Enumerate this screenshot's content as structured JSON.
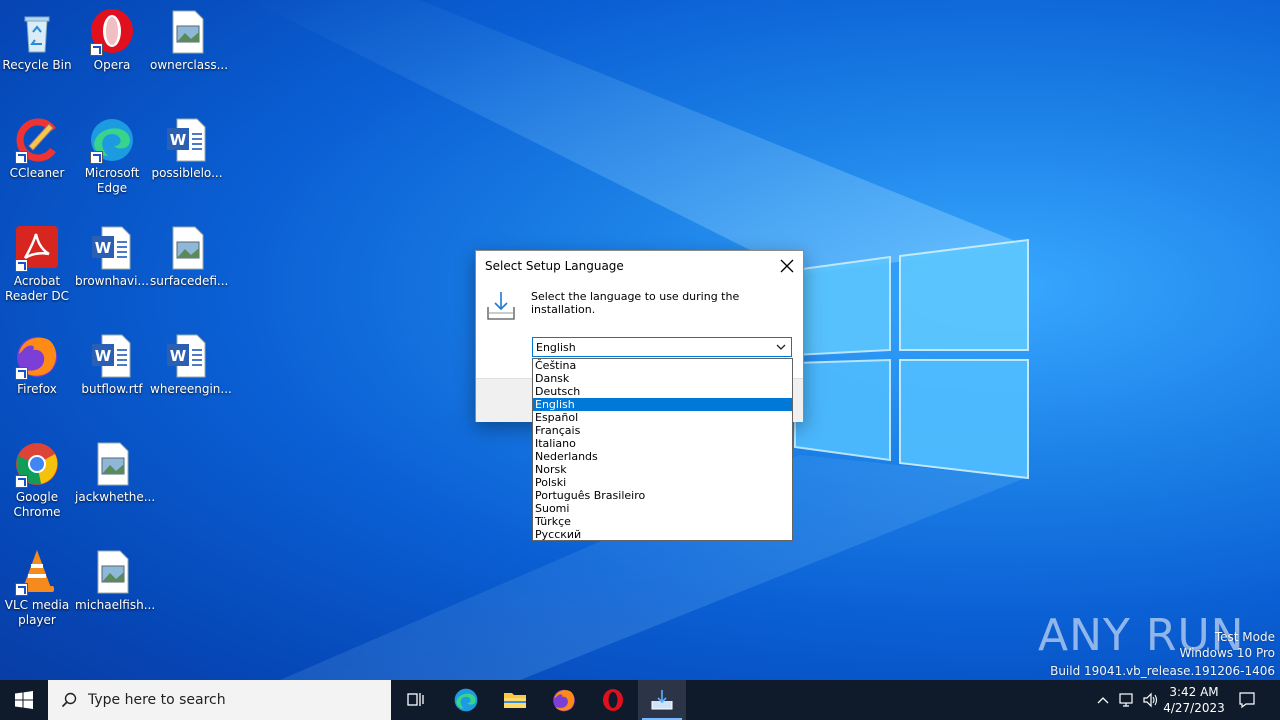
{
  "desktop": {
    "icons": [
      {
        "label": "Recycle Bin"
      },
      {
        "label": "Opera"
      },
      {
        "label": "ownerclass..."
      },
      {
        "label": "CCleaner"
      },
      {
        "label": "Microsoft Edge"
      },
      {
        "label": "possiblelo..."
      },
      {
        "label": "Acrobat Reader DC"
      },
      {
        "label": "brownhavi..."
      },
      {
        "label": "surfacedefi..."
      },
      {
        "label": "Firefox"
      },
      {
        "label": "butflow.rtf"
      },
      {
        "label": "whereengin..."
      },
      {
        "label": "Google Chrome"
      },
      {
        "label": "jackwhethe..."
      },
      {
        "label": "VLC media player"
      },
      {
        "label": "michaelfish..."
      }
    ]
  },
  "dialog": {
    "title": "Select Setup Language",
    "message": "Select the language to use during the installation.",
    "selected_language": "English",
    "languages": [
      "Čeština",
      "Dansk",
      "Deutsch",
      "English",
      "Español",
      "Français",
      "Italiano",
      "Nederlands",
      "Norsk",
      "Polski",
      "Português Brasileiro",
      "Suomi",
      "Türkçe",
      "Русский"
    ],
    "selected_index": 3
  },
  "watermark": {
    "brand": "ANY RUN",
    "line1": "Test Mode",
    "line2": "Windows 10 Pro",
    "line3": "Build 19041.vb_release.191206-1406"
  },
  "taskbar": {
    "search_placeholder": "Type here to search",
    "time": "3:42 AM",
    "date": "4/27/2023"
  },
  "colors": {
    "accent": "#0078d7",
    "taskbar": "#0f1a2b"
  }
}
